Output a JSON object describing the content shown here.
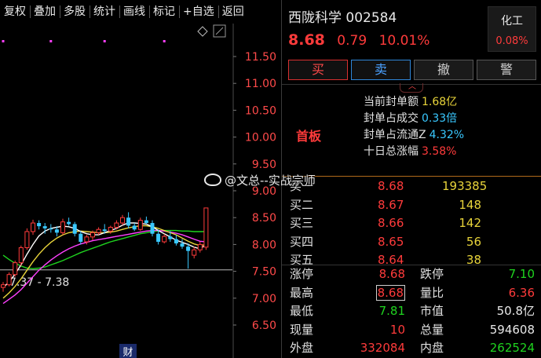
{
  "toolbar": {
    "items": [
      "复权",
      "叠加",
      "多股",
      "统计",
      "画线",
      "标记",
      "+自选",
      "返回"
    ]
  },
  "chart": {
    "y_ticks": [
      "11.50",
      "11.00",
      "10.50",
      "10.00",
      "9.50",
      "9.00",
      "8.50",
      "8.00",
      "7.50",
      "7.00",
      "6.50"
    ],
    "range_label": "7.37 - 7.38",
    "bottom_marker": "财",
    "colors": {
      "up": "#ff3b3b",
      "down": "#39c8ff",
      "ma5": "#ffffff",
      "ma10": "#e8d43a",
      "ma20": "#ff40ff",
      "ma60": "#1fd41f"
    }
  },
  "chart_data": {
    "type": "candlestick",
    "ylim": [
      6.25,
      11.75
    ],
    "y_ticks": [
      11.5,
      11.0,
      10.5,
      10.0,
      9.5,
      9.0,
      8.5,
      8.0,
      7.5,
      7.0,
      6.5
    ],
    "range_label": "7.37 - 7.38",
    "candles": [
      {
        "o": 7.2,
        "h": 7.3,
        "l": 7.12,
        "c": 7.25
      },
      {
        "o": 7.25,
        "h": 7.48,
        "l": 7.22,
        "c": 7.44
      },
      {
        "o": 7.44,
        "h": 7.7,
        "l": 7.4,
        "c": 7.66
      },
      {
        "o": 7.66,
        "h": 7.98,
        "l": 7.6,
        "c": 7.94
      },
      {
        "o": 7.94,
        "h": 8.3,
        "l": 7.9,
        "c": 8.24
      },
      {
        "o": 8.24,
        "h": 8.46,
        "l": 8.18,
        "c": 8.4
      },
      {
        "o": 8.4,
        "h": 8.45,
        "l": 8.28,
        "c": 8.34
      },
      {
        "o": 8.34,
        "h": 8.4,
        "l": 8.2,
        "c": 8.3
      },
      {
        "o": 8.3,
        "h": 8.38,
        "l": 8.22,
        "c": 8.28
      },
      {
        "o": 8.28,
        "h": 8.34,
        "l": 8.15,
        "c": 8.22
      },
      {
        "o": 8.22,
        "h": 8.48,
        "l": 8.18,
        "c": 8.42
      },
      {
        "o": 8.42,
        "h": 8.5,
        "l": 8.35,
        "c": 8.38
      },
      {
        "o": 8.38,
        "h": 8.42,
        "l": 8.15,
        "c": 8.2
      },
      {
        "o": 8.2,
        "h": 8.25,
        "l": 8.0,
        "c": 8.05
      },
      {
        "o": 8.05,
        "h": 8.18,
        "l": 8.0,
        "c": 8.14
      },
      {
        "o": 8.14,
        "h": 8.26,
        "l": 8.08,
        "c": 8.22
      },
      {
        "o": 8.22,
        "h": 8.32,
        "l": 8.18,
        "c": 8.28
      },
      {
        "o": 8.28,
        "h": 8.38,
        "l": 8.2,
        "c": 8.25
      },
      {
        "o": 8.25,
        "h": 8.35,
        "l": 8.2,
        "c": 8.32
      },
      {
        "o": 8.32,
        "h": 8.45,
        "l": 8.28,
        "c": 8.4
      },
      {
        "o": 8.4,
        "h": 8.55,
        "l": 8.36,
        "c": 8.5
      },
      {
        "o": 8.5,
        "h": 8.6,
        "l": 8.3,
        "c": 8.35
      },
      {
        "o": 8.35,
        "h": 8.4,
        "l": 8.25,
        "c": 8.28
      },
      {
        "o": 8.28,
        "h": 8.5,
        "l": 8.25,
        "c": 8.45
      },
      {
        "o": 8.45,
        "h": 8.52,
        "l": 8.38,
        "c": 8.4
      },
      {
        "o": 8.4,
        "h": 8.45,
        "l": 8.15,
        "c": 8.2
      },
      {
        "o": 8.2,
        "h": 8.28,
        "l": 8.0,
        "c": 8.05
      },
      {
        "o": 8.05,
        "h": 8.2,
        "l": 8.02,
        "c": 8.15
      },
      {
        "o": 8.15,
        "h": 8.25,
        "l": 8.05,
        "c": 8.1
      },
      {
        "o": 8.1,
        "h": 8.18,
        "l": 7.98,
        "c": 8.02
      },
      {
        "o": 8.02,
        "h": 8.1,
        "l": 7.92,
        "c": 7.96
      },
      {
        "o": 7.96,
        "h": 8.02,
        "l": 7.55,
        "c": 7.88
      },
      {
        "o": 7.8,
        "h": 7.96,
        "l": 7.74,
        "c": 7.9
      },
      {
        "o": 7.9,
        "h": 8.05,
        "l": 7.85,
        "c": 8.0
      },
      {
        "o": 7.95,
        "h": 8.68,
        "l": 7.9,
        "c": 8.68
      }
    ],
    "ma5": [
      7.2,
      7.3,
      7.45,
      7.62,
      7.82,
      8.0,
      8.16,
      8.25,
      8.3,
      8.32,
      8.34,
      8.33,
      8.3,
      8.24,
      8.2,
      8.18,
      8.18,
      8.22,
      8.26,
      8.3,
      8.36,
      8.4,
      8.4,
      8.39,
      8.38,
      8.33,
      8.26,
      8.2,
      8.14,
      8.08,
      8.04,
      8.0,
      7.95,
      7.92,
      8.0
    ],
    "ma10": [
      7.0,
      7.1,
      7.22,
      7.36,
      7.52,
      7.68,
      7.82,
      7.94,
      8.04,
      8.12,
      8.18,
      8.22,
      8.24,
      8.25,
      8.24,
      8.23,
      8.22,
      8.22,
      8.23,
      8.25,
      8.28,
      8.31,
      8.33,
      8.35,
      8.35,
      8.33,
      8.3,
      8.26,
      8.22,
      8.18,
      8.12,
      8.06,
      8.01,
      7.98,
      8.0
    ],
    "ma20": [
      6.9,
      6.98,
      7.06,
      7.16,
      7.28,
      7.4,
      7.52,
      7.62,
      7.71,
      7.79,
      7.86,
      7.92,
      7.97,
      8.01,
      8.04,
      8.07,
      8.09,
      8.11,
      8.13,
      8.15,
      8.17,
      8.19,
      8.21,
      8.23,
      8.25,
      8.26,
      8.26,
      8.25,
      8.23,
      8.21,
      8.18,
      8.14,
      8.1,
      8.06,
      8.05
    ],
    "ma60": [
      7.8,
      7.72,
      7.65,
      7.6,
      7.56,
      7.55,
      7.56,
      7.58,
      7.62,
      7.66,
      7.7,
      7.75,
      7.8,
      7.85,
      7.89,
      7.93,
      7.97,
      8.01,
      8.05,
      8.08,
      8.11,
      8.14,
      8.17,
      8.2,
      8.22,
      8.24,
      8.25,
      8.26,
      8.26,
      8.26,
      8.25,
      8.25,
      8.24,
      8.24,
      8.24
    ],
    "top_markers": [
      0,
      8,
      17,
      27
    ]
  },
  "quote": {
    "name": "西陇科学",
    "code": "002584",
    "price": "8.68",
    "change": "0.79",
    "pct": "10.01%",
    "sector_name": "化工",
    "sector_change": "0.08%"
  },
  "trade": {
    "buy": "买",
    "sell": "卖",
    "cancel": "撤",
    "alert": "警"
  },
  "seal": {
    "status": "首板",
    "rows": [
      {
        "label": "当前封单额",
        "value": "1.68亿",
        "color": "yellow"
      },
      {
        "label": "封单占成交",
        "value": "0.33倍",
        "color": "cyan"
      },
      {
        "label": "封单占流通Z",
        "value": "4.32%",
        "color": "cyan"
      },
      {
        "label": "十日总涨幅",
        "value": "3.58%",
        "color": "red"
      }
    ]
  },
  "order_book": [
    {
      "level": "买一",
      "price": "8.68",
      "volume": "193385"
    },
    {
      "level": "买二",
      "price": "8.67",
      "volume": "148"
    },
    {
      "level": "买三",
      "price": "8.66",
      "volume": "142"
    },
    {
      "level": "买四",
      "price": "8.65",
      "volume": "56"
    },
    {
      "level": "买五",
      "price": "8.64",
      "volume": "38"
    }
  ],
  "stats": [
    {
      "l1": "涨停",
      "v1": "8.68",
      "c1": "red",
      "l2": "跌停",
      "v2": "7.10",
      "c2": "green"
    },
    {
      "l1": "最高",
      "v1": "8.68",
      "c1": "red",
      "boxed": true,
      "l2": "量比",
      "v2": "6.36",
      "c2": "red"
    },
    {
      "l1": "最低",
      "v1": "7.81",
      "c1": "green",
      "l2": "市值",
      "v2": "50.8亿",
      "c2": "white"
    },
    {
      "l1": "现量",
      "v1": "10",
      "c1": "red",
      "l2": "总量",
      "v2": "594608",
      "c2": "white"
    },
    {
      "l1": "外盘",
      "v1": "332084",
      "c1": "red",
      "l2": "内盘",
      "v2": "262524",
      "c2": "green"
    }
  ],
  "watermark": "@文总--实战宗师"
}
